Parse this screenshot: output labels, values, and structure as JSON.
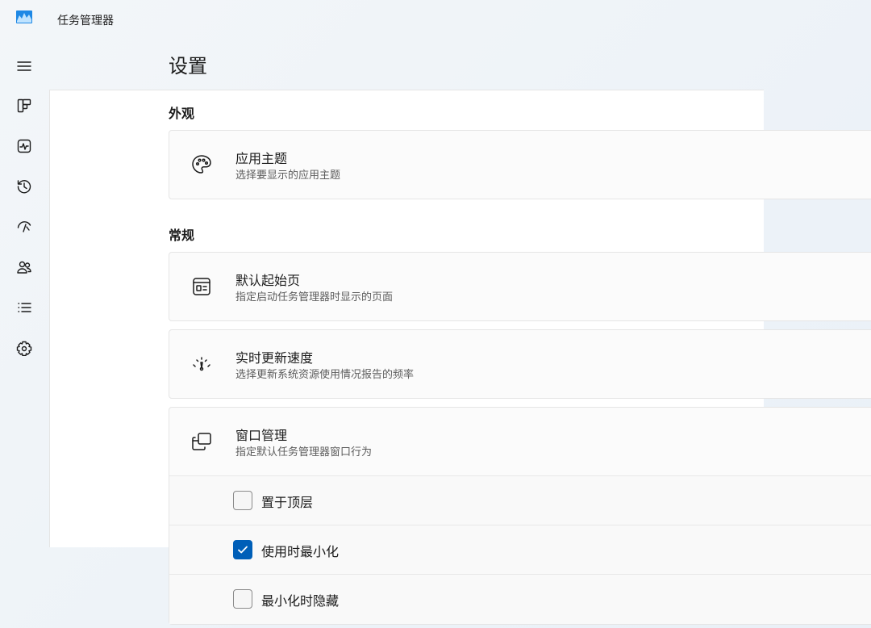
{
  "app": {
    "title": "任务管理器"
  },
  "nav": {
    "items": [
      {
        "icon": "hamburger-menu-icon"
      },
      {
        "icon": "processes-icon"
      },
      {
        "icon": "performance-icon"
      },
      {
        "icon": "app-history-icon"
      },
      {
        "icon": "startup-apps-icon"
      },
      {
        "icon": "users-icon"
      },
      {
        "icon": "details-icon"
      },
      {
        "icon": "settings-gear-icon"
      }
    ]
  },
  "page": {
    "title": "设置"
  },
  "sections": {
    "appearance": {
      "label": "外观",
      "theme": {
        "icon": "palette-icon",
        "title": "应用主题",
        "subtitle": "选择要显示的应用主题"
      }
    },
    "general": {
      "label": "常规",
      "default_page": {
        "icon": "start-page-icon",
        "title": "默认起始页",
        "subtitle": "指定启动任务管理器时显示的页面"
      },
      "update_speed": {
        "icon": "speedometer-icon",
        "title": "实时更新速度",
        "subtitle": "选择更新系统资源使用情况报告的频率"
      },
      "window_mgmt": {
        "icon": "window-stack-icon",
        "title": "窗口管理",
        "subtitle": "指定默认任务管理器窗口行为",
        "options": [
          {
            "label": "置于顶层",
            "checked": false
          },
          {
            "label": "使用时最小化",
            "checked": true
          },
          {
            "label": "最小化时隐藏",
            "checked": false
          }
        ]
      }
    }
  },
  "colors": {
    "accent": "#005fb8"
  }
}
